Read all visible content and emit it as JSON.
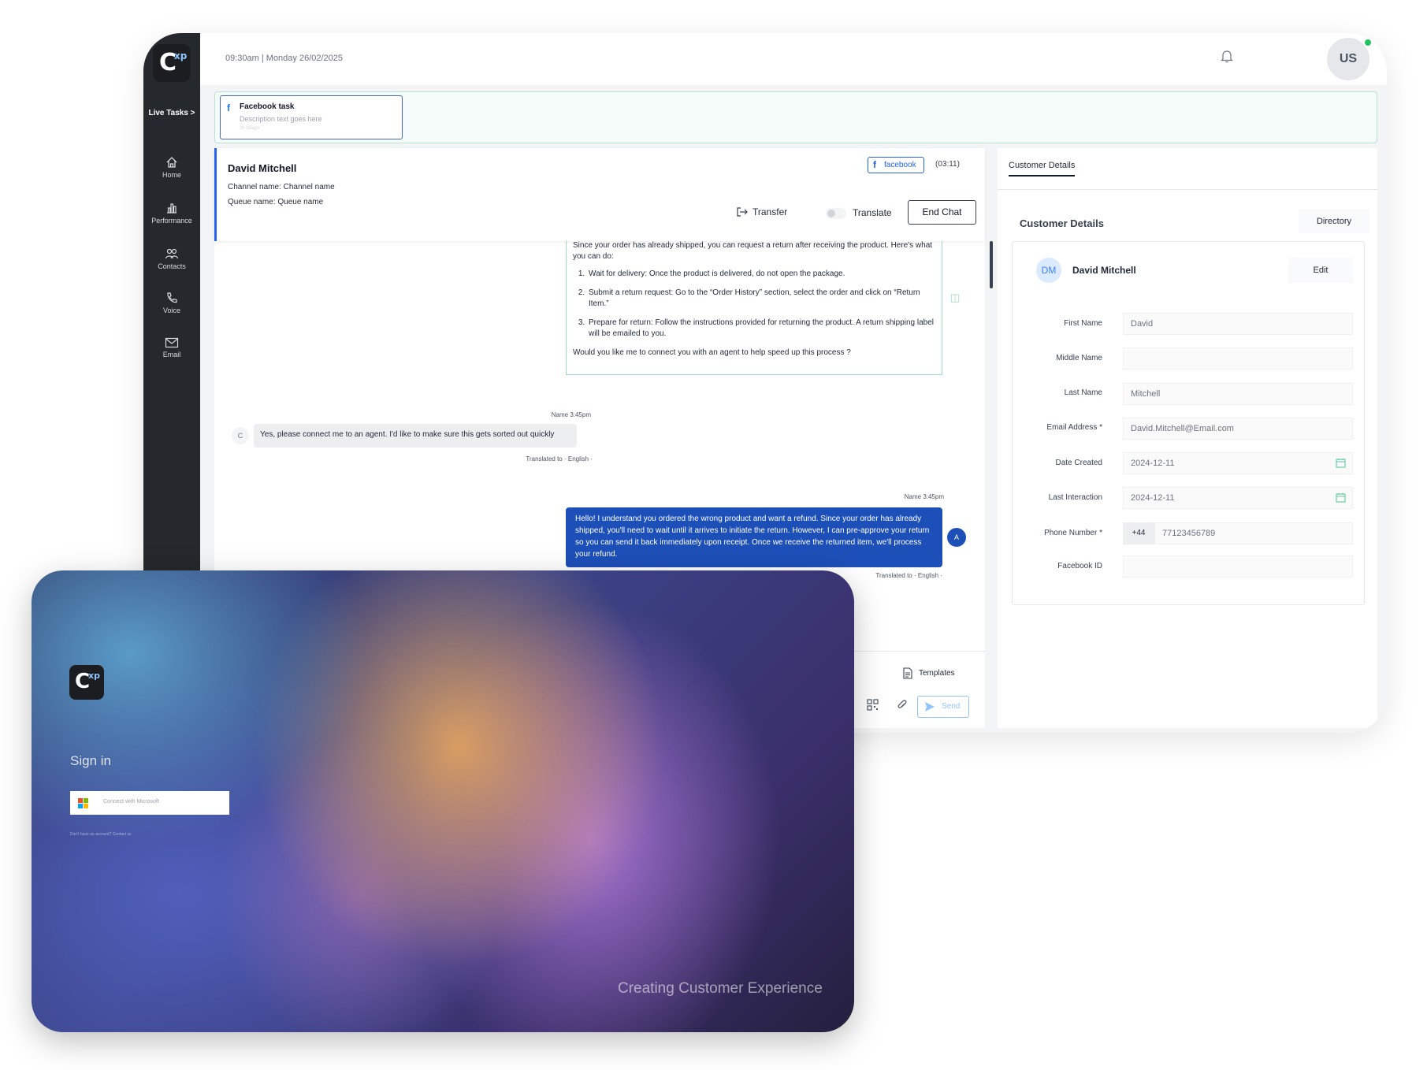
{
  "sidebar": {
    "live_tasks": "Live Tasks >",
    "items": [
      {
        "label": "Home",
        "icon": "home-icon"
      },
      {
        "label": "Performance",
        "icon": "bar-chart-icon"
      },
      {
        "label": "Contacts",
        "icon": "users-icon"
      },
      {
        "label": "Voice",
        "icon": "phone-icon"
      },
      {
        "label": "Email",
        "icon": "mail-icon"
      }
    ]
  },
  "topbar": {
    "datetime": "09:30am | Monday 26/02/2025",
    "user_initials": "US"
  },
  "task": {
    "title": "Facebook task",
    "description": "Description text goes here",
    "elapsed": "3h 00ago"
  },
  "chat": {
    "customer_name": "David Mitchell",
    "channel_line": "Channel name: Channel name",
    "queue_line": "Queue name: Queue name",
    "channel_badge": "facebook",
    "timer": "(03:11)",
    "transfer_label": "Transfer",
    "translate_label": "Translate",
    "end_chat_label": "End Chat",
    "messages": {
      "bot_intro": "Since your order has already shipped, you can request a return after receiving the product. Here's what you can do:",
      "bot_steps": [
        "Wait for delivery: Once the product is delivered, do not open the package.",
        "Submit a return request: Go to the “Order History” section, select the order and click on “Return Item.”",
        "Prepare for return: Follow the instructions provided for returning the product. A return shipping label will be emailed to you."
      ],
      "bot_outro": "Would you like me to connect you with an agent to help speed up this process ?",
      "customer_meta": "Name  3:45pm",
      "customer_initial": "C",
      "customer_text": "Yes, please connect me to an agent. I'd like to make sure this gets sorted out quickly",
      "customer_translated": "Translated to  · English ·",
      "agent_meta": "Name  3:45pm",
      "agent_initial": "A",
      "agent_text": "Hello! I understand you ordered the wrong product and want a refund. Since your order has already shipped, you'll need to wait until it arrives to initiate the return. However, I can pre-approve your return so you can send it back immediately upon receipt. Once we receive the returned item, we'll process your refund.",
      "agent_translated": "Translated to  · English ·"
    },
    "composer": {
      "templates_label": "Templates",
      "send_label": "Send"
    }
  },
  "details": {
    "tab_label": "Customer Details",
    "section_title": "Customer Details",
    "directory_label": "Directory",
    "avatar_initials": "DM",
    "name": "David Mitchell",
    "edit_label": "Edit",
    "fields": [
      {
        "label": "First Name",
        "value": "David"
      },
      {
        "label": "Middle Name",
        "value": ""
      },
      {
        "label": "Last Name",
        "value": "Mitchell"
      },
      {
        "label": "Email Address *",
        "value": "David.Mitchell@Email.com"
      },
      {
        "label": "Date Created",
        "value": "2024-12-11"
      },
      {
        "label": "Last Interaction",
        "value": "2024-12-11"
      },
      {
        "label": "Phone Number *",
        "value": "77123456789",
        "country_code": "+44"
      },
      {
        "label": "Facebook ID",
        "value": ""
      }
    ]
  },
  "signin": {
    "title": "Sign in",
    "microsoft_button": "Connect with Microsoft",
    "no_account": "Don't have an account? Contact us",
    "tagline": "Creating Customer Experience"
  },
  "colors": {
    "sidebar": "#25282c",
    "accent_blue": "#1d4fb8",
    "green_border": "#9fdbbf",
    "online": "#22c55e"
  }
}
